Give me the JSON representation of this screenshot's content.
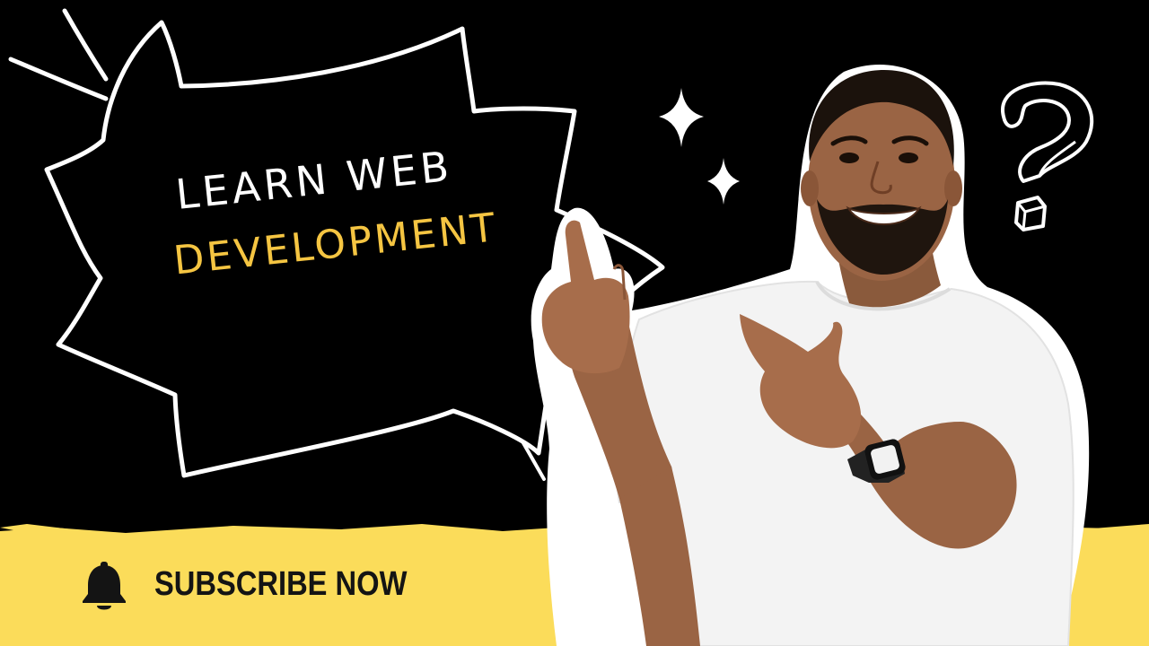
{
  "headline": {
    "line1": "LEARN WEB",
    "line2": "DEVELOPMENT"
  },
  "cta": {
    "label": "SUBSCRIBE NOW",
    "icon": "bell-icon"
  },
  "colors": {
    "background": "#000000",
    "accent_yellow": "#fbdc5a",
    "headline_white": "#ffffff",
    "headline_yellow": "#f5c542",
    "cta_text": "#141414"
  },
  "decorations": [
    "burst-speech-bubble",
    "sparkle-icon",
    "question-mark-icon",
    "speed-lines"
  ]
}
